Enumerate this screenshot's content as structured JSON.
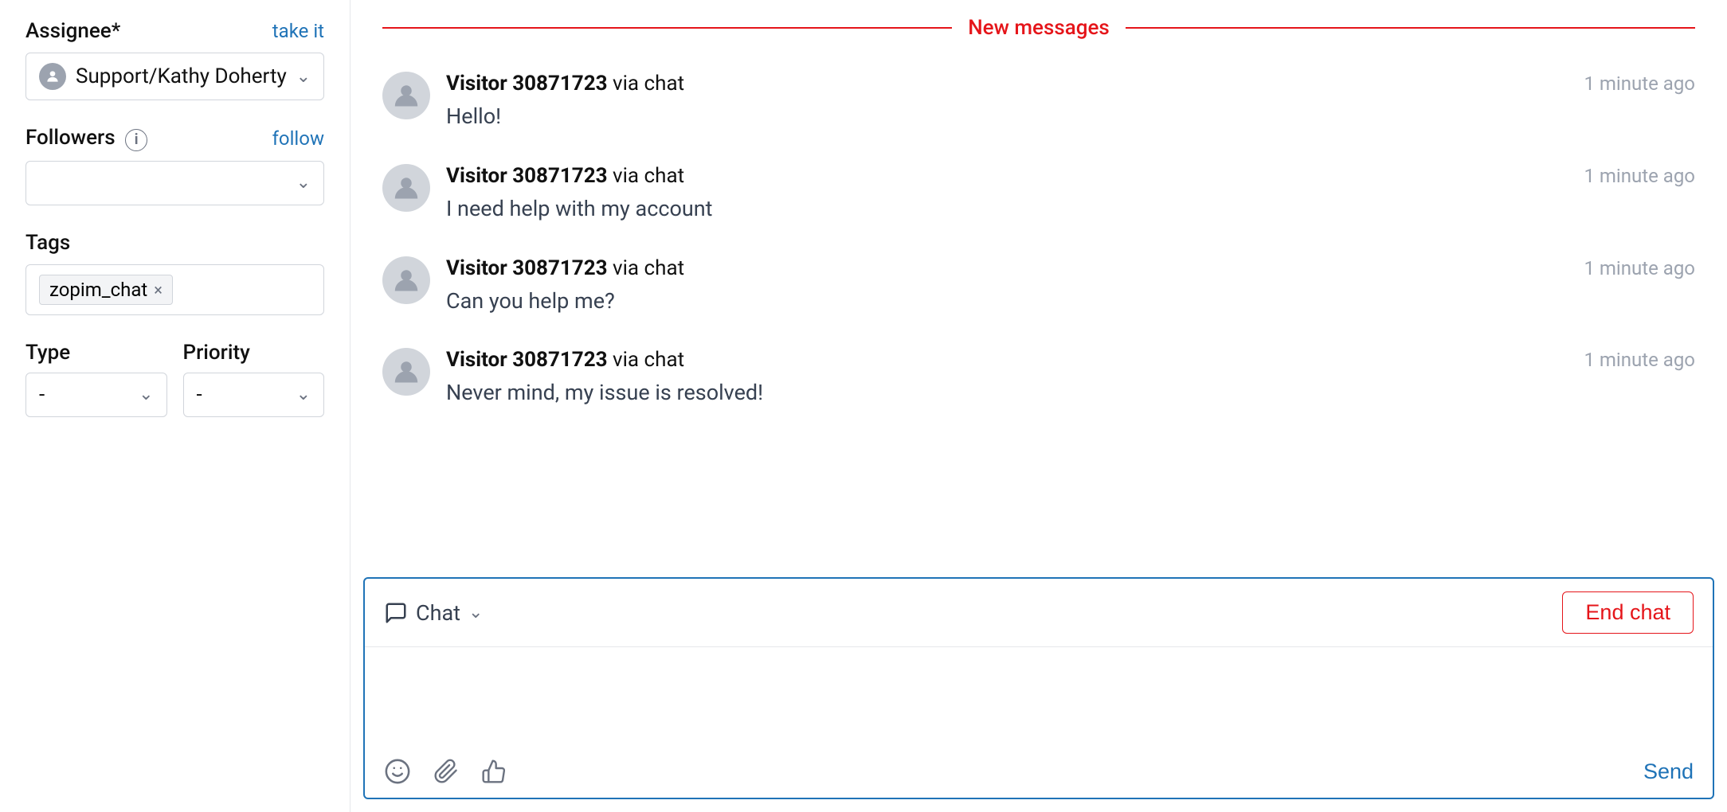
{
  "left": {
    "assignee_label": "Assignee*",
    "take_it_label": "take it",
    "assignee_value": "Support/Kathy Doherty",
    "followers_label": "Followers",
    "follow_label": "follow",
    "tags_label": "Tags",
    "tag_value": "zopim_chat",
    "type_label": "Type",
    "type_value": "-",
    "priority_label": "Priority",
    "priority_value": "-"
  },
  "chat": {
    "new_messages_label": "New messages",
    "messages": [
      {
        "sender": "Visitor 30871723",
        "via": "via chat",
        "time": "1 minute ago",
        "text": "Hello!"
      },
      {
        "sender": "Visitor 30871723",
        "via": "via chat",
        "time": "1 minute ago",
        "text": "I need help with my account"
      },
      {
        "sender": "Visitor 30871723",
        "via": "via chat",
        "time": "1 minute ago",
        "text": "Can you help me?"
      },
      {
        "sender": "Visitor 30871723",
        "via": "via chat",
        "time": "1 minute ago",
        "text": "Never mind, my issue is resolved!"
      }
    ],
    "input_mode": "Chat",
    "end_chat_label": "End chat",
    "send_label": "Send"
  }
}
